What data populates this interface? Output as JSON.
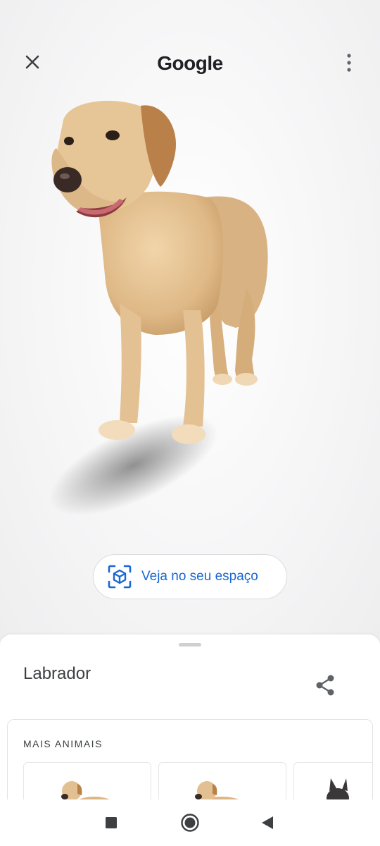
{
  "header": {
    "brand": "Google",
    "close_icon": "close-icon",
    "more_icon": "more-vert-icon"
  },
  "viewer": {
    "model": "labrador-3d-model"
  },
  "ar_button": {
    "label": "Veja no seu espaço",
    "icon": "ar-cube-icon",
    "color": "#1967d2"
  },
  "sheet": {
    "title": "Labrador",
    "share_icon": "share-icon",
    "more_animals": {
      "title": "MAIS ANIMAIS",
      "items": [
        {
          "icon": "labrador-thumbnail"
        },
        {
          "icon": "labrador-thumbnail"
        },
        {
          "icon": "french-bulldog-thumbnail"
        }
      ]
    }
  },
  "navbar": {
    "recents_icon": "square-icon",
    "home_icon": "home-circle-icon",
    "back_icon": "back-triangle-icon"
  }
}
